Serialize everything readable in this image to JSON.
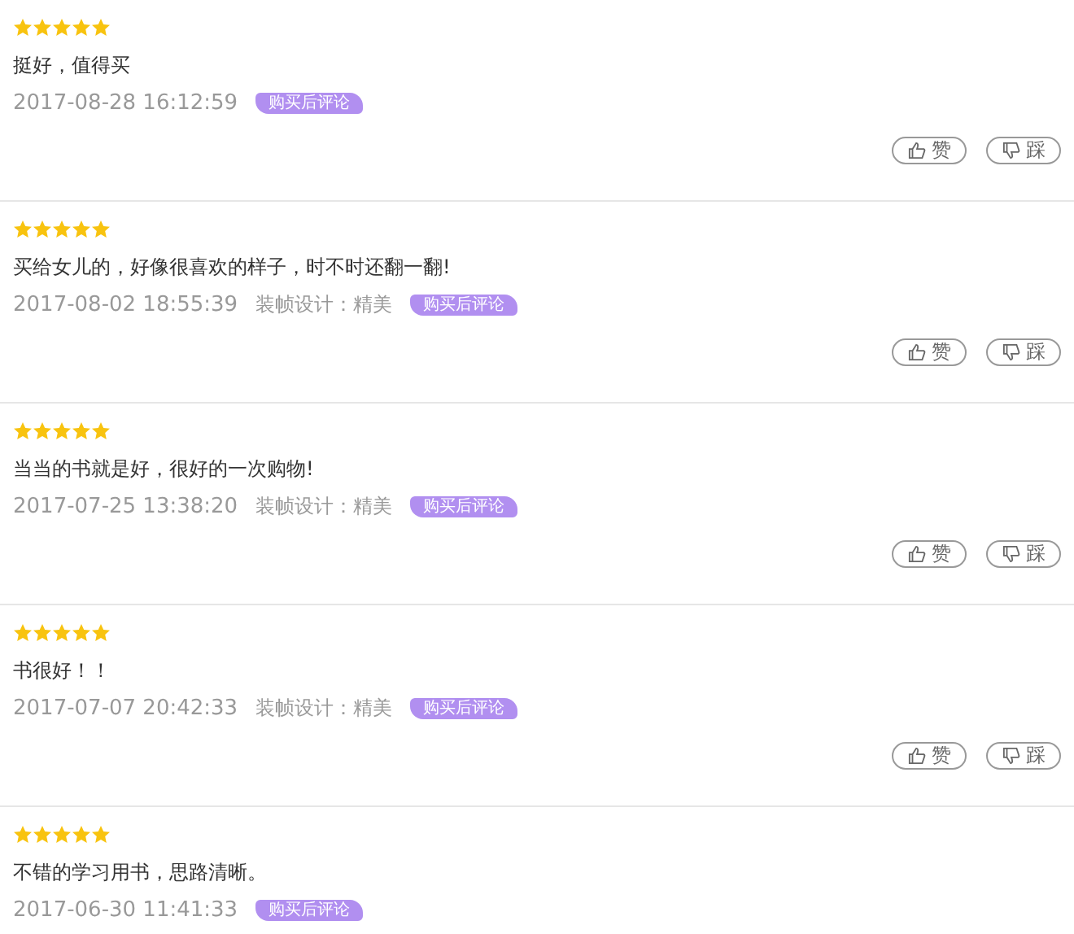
{
  "reviews": [
    {
      "stars": 5,
      "text": "挺好，值得买",
      "time": "2017-08-28 16:12:59",
      "badge": "购买后评论",
      "buttons": [
        {
          "kind": "up",
          "label": "赞"
        },
        {
          "kind": "down",
          "label": "踩"
        }
      ]
    },
    {
      "stars": 5,
      "text": "买给女儿的，好像很喜欢的样子，时不时还翻一翻!",
      "time": "2017-08-02 18:55:39",
      "design": "装帧设计：精美",
      "badge": "购买后评论",
      "buttons": [
        {
          "kind": "up",
          "label": "赞"
        },
        {
          "kind": "down",
          "label": "踩"
        }
      ]
    },
    {
      "stars": 5,
      "text": "当当的书就是好，很好的一次购物!",
      "time": "2017-07-25 13:38:20",
      "design": "装帧设计：精美",
      "badge": "购买后评论",
      "buttons": [
        {
          "kind": "up",
          "label": "赞"
        },
        {
          "kind": "down",
          "label": "踩"
        }
      ]
    },
    {
      "stars": 5,
      "text": "书很好！！",
      "time": "2017-07-07 20:42:33",
      "design": "装帧设计：精美",
      "badge": "购买后评论",
      "buttons": [
        {
          "kind": "up",
          "label": "赞"
        },
        {
          "kind": "down",
          "label": "踩"
        }
      ]
    },
    {
      "stars": 5,
      "text": "不错的学习用书，思路清晰。",
      "time": "2017-06-30 11:41:33",
      "badge": "购买后评论"
    }
  ]
}
